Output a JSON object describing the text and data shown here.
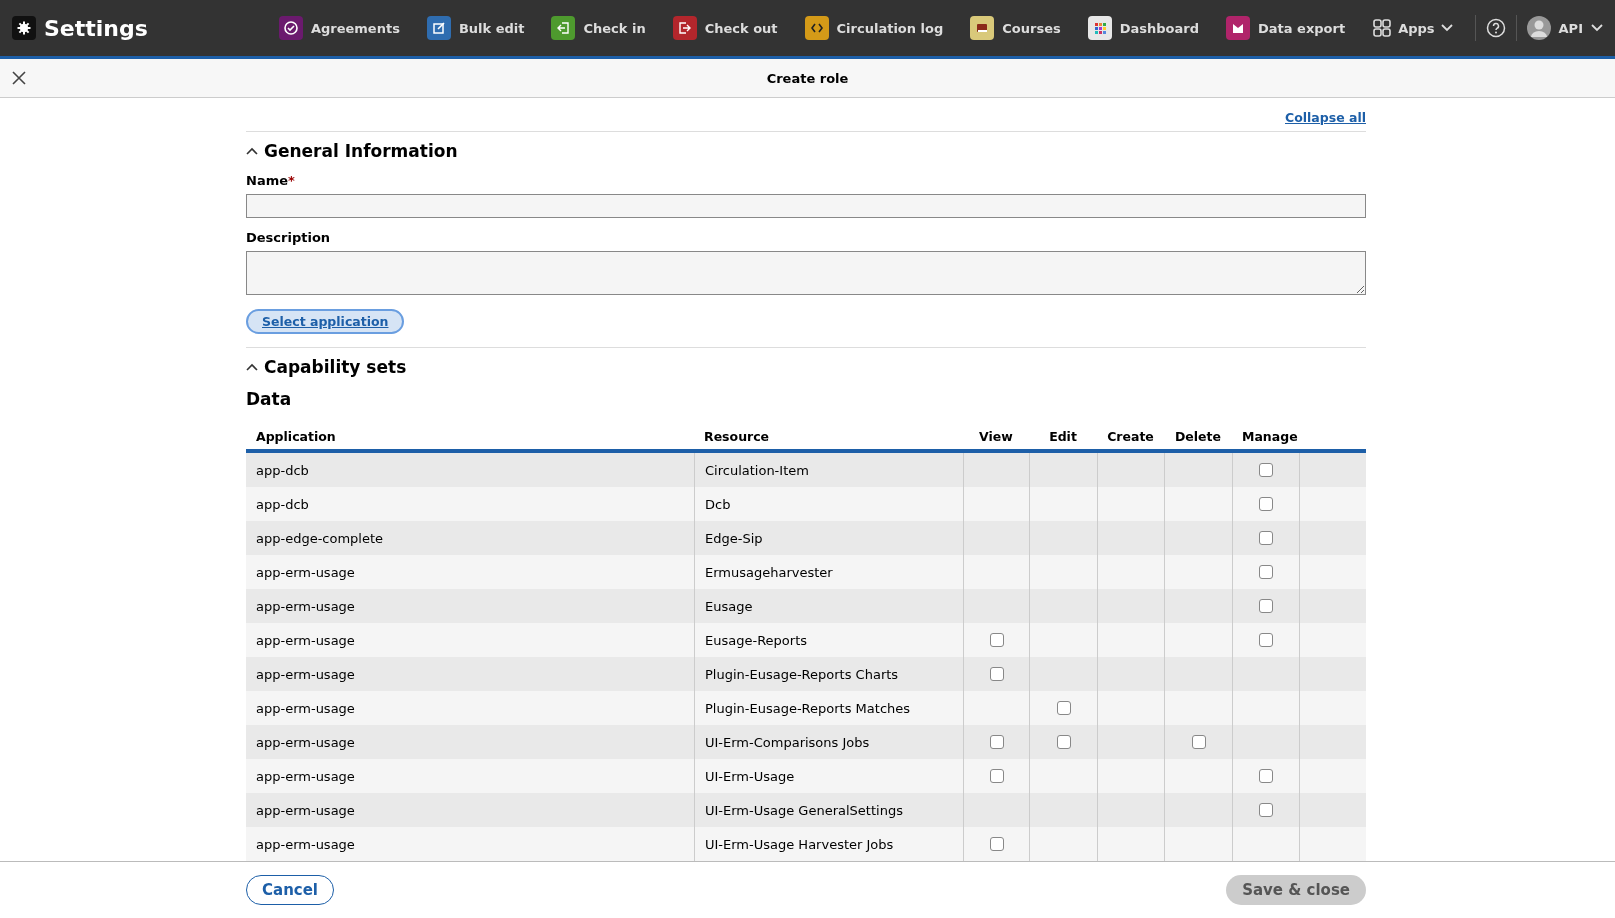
{
  "header": {
    "title": "Settings",
    "apps": [
      {
        "label": "Agreements",
        "color": "#6b1a6e"
      },
      {
        "label": "Bulk edit",
        "color": "#2f6db0"
      },
      {
        "label": "Check in",
        "color": "#4e9a2e"
      },
      {
        "label": "Check out",
        "color": "#b3262c"
      },
      {
        "label": "Circulation log",
        "color": "#d49a18"
      },
      {
        "label": "Courses",
        "color": "#d9c97a"
      },
      {
        "label": "Dashboard",
        "color": "#e8e8e8"
      },
      {
        "label": "Data export",
        "color": "#b0246a"
      }
    ],
    "apps_menu": "Apps",
    "user": "API"
  },
  "pane": {
    "title": "Create role"
  },
  "collapse_all": "Collapse all",
  "general": {
    "title": "General Information",
    "expanded": true,
    "name_label": "Name",
    "required_mark": "*",
    "description_label": "Description",
    "select_button": "Select application"
  },
  "capabilities": {
    "title": "Capability sets",
    "expanded": true,
    "subtitle": "Data",
    "columns": [
      "Application",
      "Resource",
      "View",
      "Edit",
      "Create",
      "Delete",
      "Manage"
    ],
    "rows": [
      {
        "application": "app-dcb",
        "resource": "Circulation-Item",
        "actions": [
          {
            "kind": "none"
          },
          {
            "kind": "none"
          },
          {
            "kind": "none"
          },
          {
            "kind": "none"
          },
          {
            "kind": "checkbox",
            "checked": false
          }
        ]
      },
      {
        "application": "app-dcb",
        "resource": "Dcb",
        "actions": [
          {
            "kind": "none"
          },
          {
            "kind": "none"
          },
          {
            "kind": "none"
          },
          {
            "kind": "none"
          },
          {
            "kind": "checkbox",
            "checked": false
          }
        ]
      },
      {
        "application": "app-edge-complete",
        "resource": "Edge-Sip",
        "actions": [
          {
            "kind": "none"
          },
          {
            "kind": "none"
          },
          {
            "kind": "none"
          },
          {
            "kind": "none"
          },
          {
            "kind": "checkbox",
            "checked": false
          }
        ]
      },
      {
        "application": "app-erm-usage",
        "resource": "Ermusageharvester",
        "actions": [
          {
            "kind": "none"
          },
          {
            "kind": "none"
          },
          {
            "kind": "none"
          },
          {
            "kind": "none"
          },
          {
            "kind": "checkbox",
            "checked": false
          }
        ]
      },
      {
        "application": "app-erm-usage",
        "resource": "Eusage",
        "actions": [
          {
            "kind": "none"
          },
          {
            "kind": "none"
          },
          {
            "kind": "none"
          },
          {
            "kind": "none"
          },
          {
            "kind": "checkbox",
            "checked": false
          }
        ]
      },
      {
        "application": "app-erm-usage",
        "resource": "Eusage-Reports",
        "actions": [
          {
            "kind": "checkbox",
            "checked": false
          },
          {
            "kind": "none"
          },
          {
            "kind": "none"
          },
          {
            "kind": "none"
          },
          {
            "kind": "checkbox",
            "checked": false
          }
        ]
      },
      {
        "application": "app-erm-usage",
        "resource": "Plugin-Eusage-Reports Charts",
        "actions": [
          {
            "kind": "checkbox",
            "checked": false
          },
          {
            "kind": "none"
          },
          {
            "kind": "none"
          },
          {
            "kind": "none"
          },
          {
            "kind": "none"
          }
        ]
      },
      {
        "application": "app-erm-usage",
        "resource": "Plugin-Eusage-Reports Matches",
        "actions": [
          {
            "kind": "none"
          },
          {
            "kind": "checkbox",
            "checked": false
          },
          {
            "kind": "none"
          },
          {
            "kind": "none"
          },
          {
            "kind": "none"
          }
        ]
      },
      {
        "application": "app-erm-usage",
        "resource": "UI-Erm-Comparisons Jobs",
        "actions": [
          {
            "kind": "checkbox",
            "checked": false
          },
          {
            "kind": "checkbox",
            "checked": false
          },
          {
            "kind": "none"
          },
          {
            "kind": "checkbox",
            "checked": false
          },
          {
            "kind": "none"
          }
        ]
      },
      {
        "application": "app-erm-usage",
        "resource": "UI-Erm-Usage",
        "actions": [
          {
            "kind": "checkbox",
            "checked": false
          },
          {
            "kind": "none"
          },
          {
            "kind": "none"
          },
          {
            "kind": "none"
          },
          {
            "kind": "checkbox",
            "checked": false
          }
        ]
      },
      {
        "application": "app-erm-usage",
        "resource": "UI-Erm-Usage GeneralSettings",
        "actions": [
          {
            "kind": "none"
          },
          {
            "kind": "none"
          },
          {
            "kind": "none"
          },
          {
            "kind": "none"
          },
          {
            "kind": "checkbox",
            "checked": false
          }
        ]
      },
      {
        "application": "app-erm-usage",
        "resource": "UI-Erm-Usage Harvester Jobs",
        "actions": [
          {
            "kind": "checkbox",
            "checked": false
          },
          {
            "kind": "none"
          },
          {
            "kind": "none"
          },
          {
            "kind": "none"
          },
          {
            "kind": "none"
          }
        ]
      }
    ]
  },
  "footer": {
    "cancel": "Cancel",
    "save": "Save & close",
    "save_disabled": true
  }
}
